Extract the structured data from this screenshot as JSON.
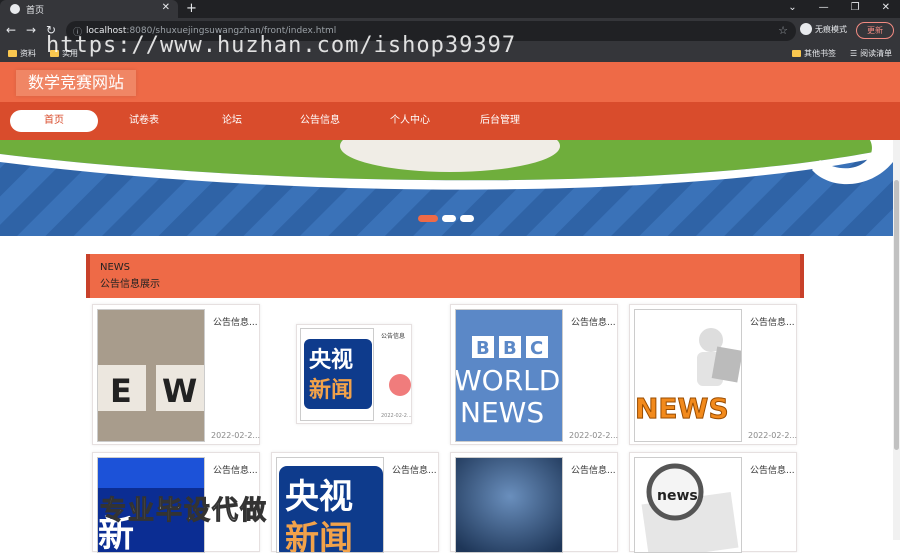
{
  "browser": {
    "tab_title": "首页",
    "url_host": "localhost",
    "url_rest": ":8080/shuxuejingsuwangzhan/front/index.html",
    "incognito_label": "无痕模式",
    "update_label": "更新",
    "bookmarks": [
      "资料",
      "实用",
      "其他书签",
      "阅读清单"
    ],
    "watermark": "https://www.huzhan.com/ishop39397"
  },
  "site": {
    "title": "数学竞赛网站",
    "nav": [
      "首页",
      "试卷表",
      "论坛",
      "公告信息",
      "个人中心",
      "后台管理"
    ],
    "news_en": "NEWS",
    "news_cn": "公告信息展示"
  },
  "cards": [
    {
      "title": "公告信息...",
      "date": "2022-02-2...",
      "img_text": "E W"
    },
    {
      "title": "公告信息",
      "date": "2022-02-2...",
      "img_text": "央视新闻"
    },
    {
      "title": "公告信息...",
      "date": "2022-02-2...",
      "img_text": "BBC WORLD NEWS"
    },
    {
      "title": "公告信息...",
      "date": "2022-02-2...",
      "img_text": "NEWS"
    },
    {
      "title": "公告信息...",
      "img_text": "新"
    },
    {
      "title": "公告信息...",
      "img_text": "央视新闻"
    },
    {
      "title": "公告信息..."
    },
    {
      "title": "公告信息...",
      "img_text": "news"
    }
  ],
  "overlay_text": "专业毕设代做",
  "colors": {
    "header": "#ee6a47",
    "nav": "#d94c2c",
    "accent_border": "#c8412a"
  }
}
